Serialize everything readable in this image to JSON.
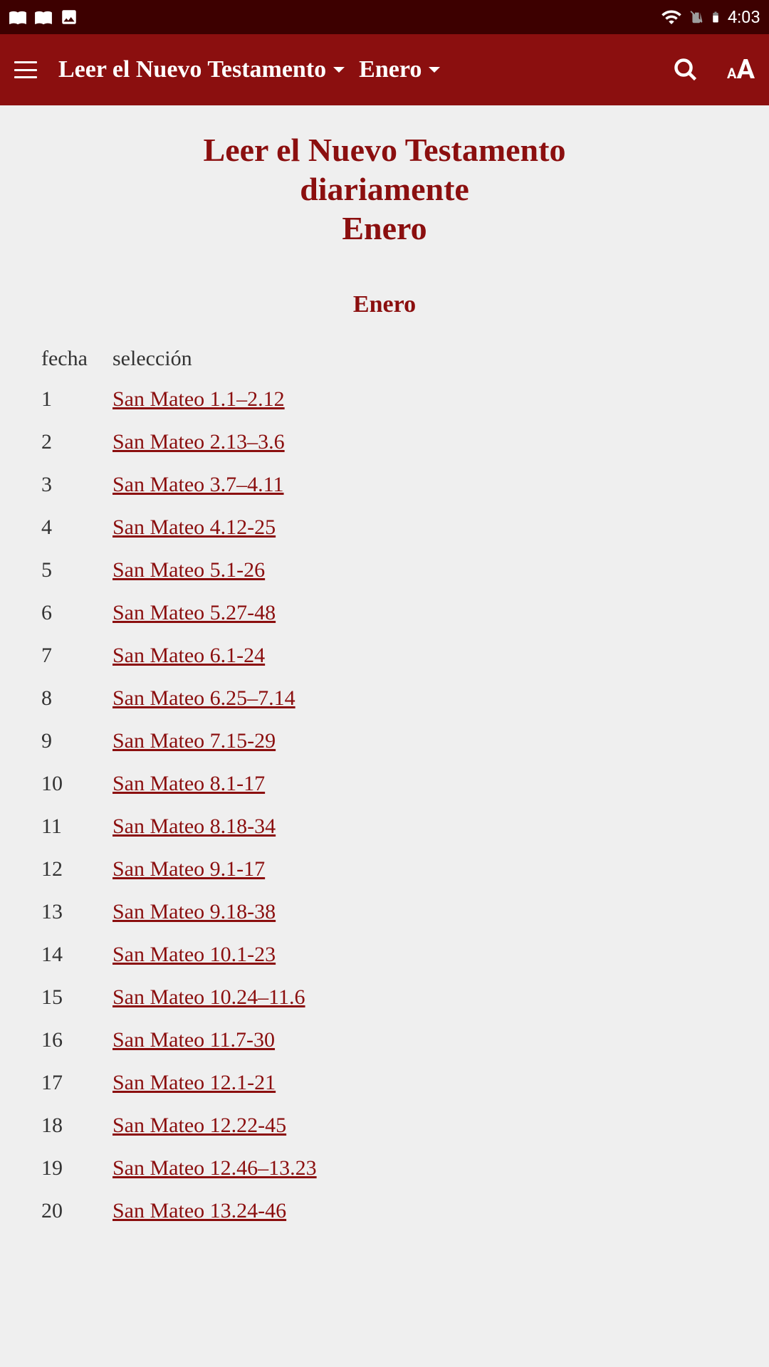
{
  "status": {
    "time": "4:03"
  },
  "appBar": {
    "dropdown1": "Leer el Nuevo Testamento",
    "dropdown2": "Enero"
  },
  "page": {
    "title_line1": "Leer el Nuevo Testamento",
    "title_line2": "diariamente",
    "title_line3": "Enero",
    "section_title": "Enero"
  },
  "table": {
    "header_date": "fecha",
    "header_selection": "selección",
    "rows": [
      {
        "date": "1",
        "reading": "San Mateo 1.1–2.12"
      },
      {
        "date": "2",
        "reading": "San Mateo 2.13–3.6"
      },
      {
        "date": "3",
        "reading": "San Mateo 3.7–4.11"
      },
      {
        "date": "4",
        "reading": "San Mateo 4.12-25"
      },
      {
        "date": "5",
        "reading": "San Mateo 5.1-26"
      },
      {
        "date": "6",
        "reading": "San Mateo 5.27-48"
      },
      {
        "date": "7",
        "reading": "San Mateo 6.1-24"
      },
      {
        "date": "8",
        "reading": "San Mateo 6.25–7.14"
      },
      {
        "date": "9",
        "reading": "San Mateo 7.15-29"
      },
      {
        "date": "10",
        "reading": "San Mateo 8.1-17"
      },
      {
        "date": "11",
        "reading": "San Mateo 8.18-34"
      },
      {
        "date": "12",
        "reading": "San Mateo 9.1-17"
      },
      {
        "date": "13",
        "reading": "San Mateo 9.18-38"
      },
      {
        "date": "14",
        "reading": "San Mateo 10.1-23"
      },
      {
        "date": "15",
        "reading": "San Mateo 10.24–11.6"
      },
      {
        "date": "16",
        "reading": "San Mateo 11.7-30"
      },
      {
        "date": "17",
        "reading": "San Mateo 12.1-21"
      },
      {
        "date": "18",
        "reading": "San Mateo 12.22-45"
      },
      {
        "date": "19",
        "reading": "San Mateo 12.46–13.23"
      },
      {
        "date": "20",
        "reading": "San Mateo 13.24-46"
      }
    ]
  }
}
